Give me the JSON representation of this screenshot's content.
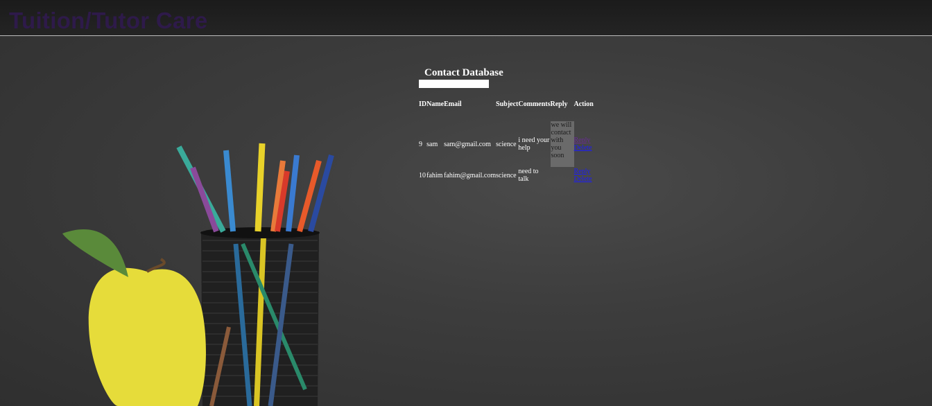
{
  "header": {
    "site_title": "Tuition/Tutor Care"
  },
  "panel": {
    "title": "Contact Database"
  },
  "table": {
    "columns": [
      "ID",
      "Name",
      "Email",
      "Subject",
      "Comments",
      "Reply",
      "Action"
    ],
    "rows": [
      {
        "id": "9",
        "name": "sam",
        "email": "sam@gmail.com",
        "subject": "science",
        "comments": "i need your help",
        "reply": "we will contact with you soon",
        "actions": [
          "Reply",
          "Delete"
        ]
      },
      {
        "id": "10",
        "name": "fahim",
        "email": "fahim@gmail.com",
        "subject": "science",
        "comments": "need to talk",
        "reply": "",
        "actions": [
          "Reply",
          "Delete"
        ]
      }
    ]
  },
  "colors": {
    "site_title": "#2e1a4a",
    "visited_link": "#6a2a9a",
    "link": "#1a1aff",
    "reply_box": "#6a6a6a"
  }
}
